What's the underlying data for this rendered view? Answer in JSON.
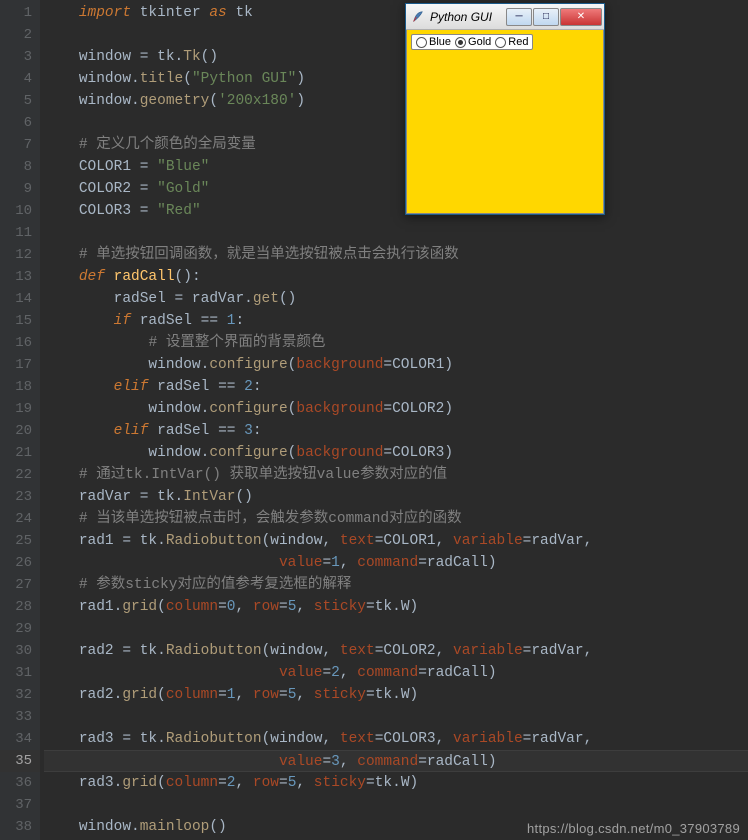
{
  "lines_count": 38,
  "highlight_line": 35,
  "code": {
    "l1": [
      [
        "kw",
        "import"
      ],
      [
        "id",
        " tkinter "
      ],
      [
        "kw",
        "as"
      ],
      [
        "id",
        " tk"
      ]
    ],
    "l2": [],
    "l3": [
      [
        "id",
        "window "
      ],
      [
        "op",
        "="
      ],
      [
        "id",
        " tk"
      ],
      [
        "dot",
        "."
      ],
      [
        "call",
        "Tk"
      ],
      [
        "op",
        "()"
      ]
    ],
    "l4": [
      [
        "id",
        "window"
      ],
      [
        "dot",
        "."
      ],
      [
        "call",
        "title"
      ],
      [
        "op",
        "("
      ],
      [
        "str",
        "\"Python GUI\""
      ],
      [
        "op",
        ")"
      ]
    ],
    "l5": [
      [
        "id",
        "window"
      ],
      [
        "dot",
        "."
      ],
      [
        "call",
        "geometry"
      ],
      [
        "op",
        "("
      ],
      [
        "str",
        "'200x180'"
      ],
      [
        "op",
        ")"
      ]
    ],
    "l6": [],
    "l7": [
      [
        "cmt",
        "# 定义几个颜色的全局变量"
      ]
    ],
    "l8": [
      [
        "id",
        "COLOR1 "
      ],
      [
        "op",
        "="
      ],
      [
        "id",
        " "
      ],
      [
        "str",
        "\"Blue\""
      ]
    ],
    "l9": [
      [
        "id",
        "COLOR2 "
      ],
      [
        "op",
        "="
      ],
      [
        "id",
        " "
      ],
      [
        "str",
        "\"Gold\""
      ]
    ],
    "l10": [
      [
        "id",
        "COLOR3 "
      ],
      [
        "op",
        "="
      ],
      [
        "id",
        " "
      ],
      [
        "str",
        "\"Red\""
      ]
    ],
    "l11": [],
    "l12": [
      [
        "cmt",
        "# 单选按钮回调函数，就是当单选按钮被点击会执行该函数"
      ]
    ],
    "l13": [
      [
        "def",
        "def "
      ],
      [
        "fn",
        "radCall"
      ],
      [
        "op",
        "():"
      ]
    ],
    "l14": [
      [
        "id",
        "    radSel "
      ],
      [
        "op",
        "="
      ],
      [
        "id",
        " radVar"
      ],
      [
        "dot",
        "."
      ],
      [
        "call",
        "get"
      ],
      [
        "op",
        "()"
      ]
    ],
    "l15": [
      [
        "id",
        "    "
      ],
      [
        "kw",
        "if"
      ],
      [
        "id",
        " radSel "
      ],
      [
        "op",
        "=="
      ],
      [
        "id",
        " "
      ],
      [
        "num",
        "1"
      ],
      [
        "op",
        ":"
      ]
    ],
    "l16": [
      [
        "id",
        "        "
      ],
      [
        "cmt",
        "# 设置整个界面的背景颜色"
      ]
    ],
    "l17": [
      [
        "id",
        "        window"
      ],
      [
        "dot",
        "."
      ],
      [
        "call",
        "configure"
      ],
      [
        "op",
        "("
      ],
      [
        "param",
        "background"
      ],
      [
        "op",
        "="
      ],
      [
        "id",
        "COLOR1"
      ],
      [
        "op",
        ")"
      ]
    ],
    "l18": [
      [
        "id",
        "    "
      ],
      [
        "kw",
        "elif"
      ],
      [
        "id",
        " radSel "
      ],
      [
        "op",
        "=="
      ],
      [
        "id",
        " "
      ],
      [
        "num",
        "2"
      ],
      [
        "op",
        ":"
      ]
    ],
    "l19": [
      [
        "id",
        "        window"
      ],
      [
        "dot",
        "."
      ],
      [
        "call",
        "configure"
      ],
      [
        "op",
        "("
      ],
      [
        "param",
        "background"
      ],
      [
        "op",
        "="
      ],
      [
        "id",
        "COLOR2"
      ],
      [
        "op",
        ")"
      ]
    ],
    "l20": [
      [
        "id",
        "    "
      ],
      [
        "kw",
        "elif"
      ],
      [
        "id",
        " radSel "
      ],
      [
        "op",
        "=="
      ],
      [
        "id",
        " "
      ],
      [
        "num",
        "3"
      ],
      [
        "op",
        ":"
      ]
    ],
    "l21": [
      [
        "id",
        "        window"
      ],
      [
        "dot",
        "."
      ],
      [
        "call",
        "configure"
      ],
      [
        "op",
        "("
      ],
      [
        "param",
        "background"
      ],
      [
        "op",
        "="
      ],
      [
        "id",
        "COLOR3"
      ],
      [
        "op",
        ")"
      ]
    ],
    "l22": [
      [
        "cmt",
        "# 通过tk.IntVar() 获取单选按钮value参数对应的值"
      ]
    ],
    "l23": [
      [
        "id",
        "radVar "
      ],
      [
        "op",
        "="
      ],
      [
        "id",
        " tk"
      ],
      [
        "dot",
        "."
      ],
      [
        "call",
        "IntVar"
      ],
      [
        "op",
        "()"
      ]
    ],
    "l24": [
      [
        "cmt",
        "# 当该单选按钮被点击时，会触发参数command对应的函数"
      ]
    ],
    "l25": [
      [
        "id",
        "rad1 "
      ],
      [
        "op",
        "="
      ],
      [
        "id",
        " tk"
      ],
      [
        "dot",
        "."
      ],
      [
        "call",
        "Radiobutton"
      ],
      [
        "op",
        "("
      ],
      [
        "id",
        "window"
      ],
      [
        "op",
        ", "
      ],
      [
        "param",
        "text"
      ],
      [
        "op",
        "="
      ],
      [
        "id",
        "COLOR1"
      ],
      [
        "op",
        ", "
      ],
      [
        "param",
        "variable"
      ],
      [
        "op",
        "="
      ],
      [
        "id",
        "radVar"
      ],
      [
        "op",
        ","
      ]
    ],
    "l26": [
      [
        "id",
        "                       "
      ],
      [
        "param",
        "value"
      ],
      [
        "op",
        "="
      ],
      [
        "num",
        "1"
      ],
      [
        "op",
        ", "
      ],
      [
        "param",
        "command"
      ],
      [
        "op",
        "="
      ],
      [
        "id",
        "radCall"
      ],
      [
        "op",
        ")"
      ]
    ],
    "l27": [
      [
        "cmt",
        "# 参数sticky对应的值参考复选框的解释"
      ]
    ],
    "l28": [
      [
        "id",
        "rad1"
      ],
      [
        "dot",
        "."
      ],
      [
        "call",
        "grid"
      ],
      [
        "op",
        "("
      ],
      [
        "param",
        "column"
      ],
      [
        "op",
        "="
      ],
      [
        "num",
        "0"
      ],
      [
        "op",
        ", "
      ],
      [
        "param",
        "row"
      ],
      [
        "op",
        "="
      ],
      [
        "num",
        "5"
      ],
      [
        "op",
        ", "
      ],
      [
        "param",
        "sticky"
      ],
      [
        "op",
        "="
      ],
      [
        "id",
        "tk"
      ],
      [
        "dot",
        "."
      ],
      [
        "id",
        "W"
      ],
      [
        "op",
        ")"
      ]
    ],
    "l29": [],
    "l30": [
      [
        "id",
        "rad2 "
      ],
      [
        "op",
        "="
      ],
      [
        "id",
        " tk"
      ],
      [
        "dot",
        "."
      ],
      [
        "call",
        "Radiobutton"
      ],
      [
        "op",
        "("
      ],
      [
        "id",
        "window"
      ],
      [
        "op",
        ", "
      ],
      [
        "param",
        "text"
      ],
      [
        "op",
        "="
      ],
      [
        "id",
        "COLOR2"
      ],
      [
        "op",
        ", "
      ],
      [
        "param",
        "variable"
      ],
      [
        "op",
        "="
      ],
      [
        "id",
        "radVar"
      ],
      [
        "op",
        ","
      ]
    ],
    "l31": [
      [
        "id",
        "                       "
      ],
      [
        "param",
        "value"
      ],
      [
        "op",
        "="
      ],
      [
        "num",
        "2"
      ],
      [
        "op",
        ", "
      ],
      [
        "param",
        "command"
      ],
      [
        "op",
        "="
      ],
      [
        "id",
        "radCall"
      ],
      [
        "op",
        ")"
      ]
    ],
    "l32": [
      [
        "id",
        "rad2"
      ],
      [
        "dot",
        "."
      ],
      [
        "call",
        "grid"
      ],
      [
        "op",
        "("
      ],
      [
        "param",
        "column"
      ],
      [
        "op",
        "="
      ],
      [
        "num",
        "1"
      ],
      [
        "op",
        ", "
      ],
      [
        "param",
        "row"
      ],
      [
        "op",
        "="
      ],
      [
        "num",
        "5"
      ],
      [
        "op",
        ", "
      ],
      [
        "param",
        "sticky"
      ],
      [
        "op",
        "="
      ],
      [
        "id",
        "tk"
      ],
      [
        "dot",
        "."
      ],
      [
        "id",
        "W"
      ],
      [
        "op",
        ")"
      ]
    ],
    "l33": [],
    "l34": [
      [
        "id",
        "rad3 "
      ],
      [
        "op",
        "="
      ],
      [
        "id",
        " tk"
      ],
      [
        "dot",
        "."
      ],
      [
        "call",
        "Radiobutton"
      ],
      [
        "op",
        "("
      ],
      [
        "id",
        "window"
      ],
      [
        "op",
        ", "
      ],
      [
        "param",
        "text"
      ],
      [
        "op",
        "="
      ],
      [
        "id",
        "COLOR3"
      ],
      [
        "op",
        ", "
      ],
      [
        "param",
        "variable"
      ],
      [
        "op",
        "="
      ],
      [
        "id",
        "radVar"
      ],
      [
        "op",
        ","
      ]
    ],
    "l35": [
      [
        "id",
        "                       "
      ],
      [
        "param",
        "value"
      ],
      [
        "op",
        "="
      ],
      [
        "num",
        "3"
      ],
      [
        "op",
        ", "
      ],
      [
        "param",
        "command"
      ],
      [
        "op",
        "="
      ],
      [
        "id",
        "radCall"
      ],
      [
        "op",
        ")"
      ]
    ],
    "l36": [
      [
        "id",
        "rad3"
      ],
      [
        "dot",
        "."
      ],
      [
        "call",
        "grid"
      ],
      [
        "op",
        "("
      ],
      [
        "param",
        "column"
      ],
      [
        "op",
        "="
      ],
      [
        "num",
        "2"
      ],
      [
        "op",
        ", "
      ],
      [
        "param",
        "row"
      ],
      [
        "op",
        "="
      ],
      [
        "num",
        "5"
      ],
      [
        "op",
        ", "
      ],
      [
        "param",
        "sticky"
      ],
      [
        "op",
        "="
      ],
      [
        "id",
        "tk"
      ],
      [
        "dot",
        "."
      ],
      [
        "id",
        "W"
      ],
      [
        "op",
        ")"
      ]
    ],
    "l37": [],
    "l38": [
      [
        "id",
        "window"
      ],
      [
        "dot",
        "."
      ],
      [
        "call",
        "mainloop"
      ],
      [
        "op",
        "()"
      ]
    ]
  },
  "tk": {
    "title": "Python GUI",
    "radios": [
      {
        "label": "Blue",
        "selected": false
      },
      {
        "label": "Gold",
        "selected": true
      },
      {
        "label": "Red",
        "selected": false
      }
    ],
    "bg_color": "#ffd700"
  },
  "watermark": "https://blog.csdn.net/m0_37903789"
}
